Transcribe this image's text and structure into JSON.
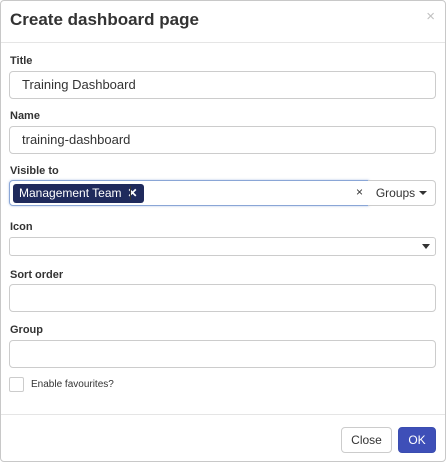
{
  "dialog": {
    "title": "Create dashboard page",
    "close_symbol": "×"
  },
  "fields": {
    "title": {
      "label": "Title",
      "value": "Training Dashboard"
    },
    "name": {
      "label": "Name",
      "value": "training-dashboard"
    },
    "visible_to": {
      "label": "Visible to",
      "tags": [
        {
          "label": "Management Team",
          "remove_symbol": "✕"
        }
      ],
      "clear_symbol": "×",
      "groups_button_label": "Groups"
    },
    "icon": {
      "label": "Icon",
      "value": ""
    },
    "sort_order": {
      "label": "Sort order",
      "value": ""
    },
    "group": {
      "label": "Group",
      "value": ""
    },
    "enable_favourites": {
      "label": "Enable favourites?",
      "checked": false
    }
  },
  "footer": {
    "close_label": "Close",
    "ok_label": "OK"
  },
  "colors": {
    "primary": "#3e4fb8",
    "tag_bg": "#1f2a5c"
  }
}
